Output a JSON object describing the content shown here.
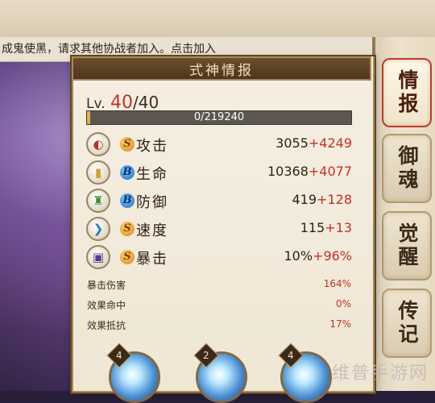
{
  "notice": "成鬼使黑，请求其他协战者加入。点击加入",
  "panel": {
    "title": "式神情报"
  },
  "level": {
    "label": "Lv.",
    "current": "40",
    "separator": "/",
    "max": "40"
  },
  "exp": {
    "text": "0/219240",
    "fraction": 0
  },
  "stats": [
    {
      "icon": "fan-icon",
      "grade": "S",
      "name": "攻击",
      "base": "3055",
      "bonus": "+4249"
    },
    {
      "icon": "scroll-icon",
      "grade": "B",
      "name": "生命",
      "base": "10368",
      "bonus": "+4077"
    },
    {
      "icon": "armor-icon",
      "grade": "B",
      "name": "防御",
      "base": "419",
      "bonus": "+128"
    },
    {
      "icon": "boot-icon",
      "grade": "S",
      "name": "速度",
      "base": "115",
      "bonus": "+13"
    },
    {
      "icon": "talisman-icon",
      "grade": "S",
      "name": "暴击",
      "base": "10%",
      "bonus": "+96%"
    }
  ],
  "sub_stats": [
    {
      "name": "暴击伤害",
      "value": "164%"
    },
    {
      "name": "效果命中",
      "value": "0%"
    },
    {
      "name": "效果抵抗",
      "value": "17%"
    }
  ],
  "side_tabs": [
    {
      "label": "情报",
      "active": true
    },
    {
      "label": "御魂",
      "active": false
    },
    {
      "label": "觉醒",
      "active": false
    },
    {
      "label": "传记",
      "active": false
    }
  ],
  "skills": [
    {
      "level": "4"
    },
    {
      "level": "2"
    },
    {
      "level": "4"
    }
  ],
  "watermark": "维普手游网",
  "colors": {
    "accent": "#c0322a",
    "panel": "#f3ecdd",
    "header": "#5a3f24"
  }
}
